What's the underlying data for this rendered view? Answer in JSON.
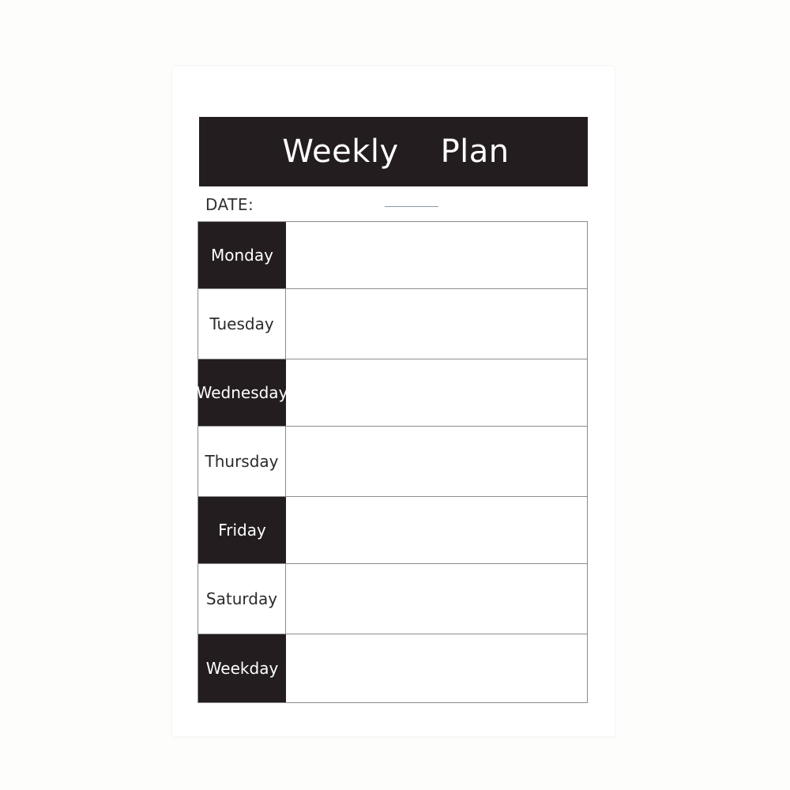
{
  "planner": {
    "title": "Weekly    Plan",
    "date_label": "DATE:",
    "days": [
      "Monday",
      "Tuesday",
      "Wednesday",
      "Thursday",
      "Friday",
      "Saturday",
      "Weekday"
    ]
  },
  "colors": {
    "header_background": "#231d1f",
    "page_background": "#fdfdfb",
    "grid_lines": "#8d8d8d"
  }
}
